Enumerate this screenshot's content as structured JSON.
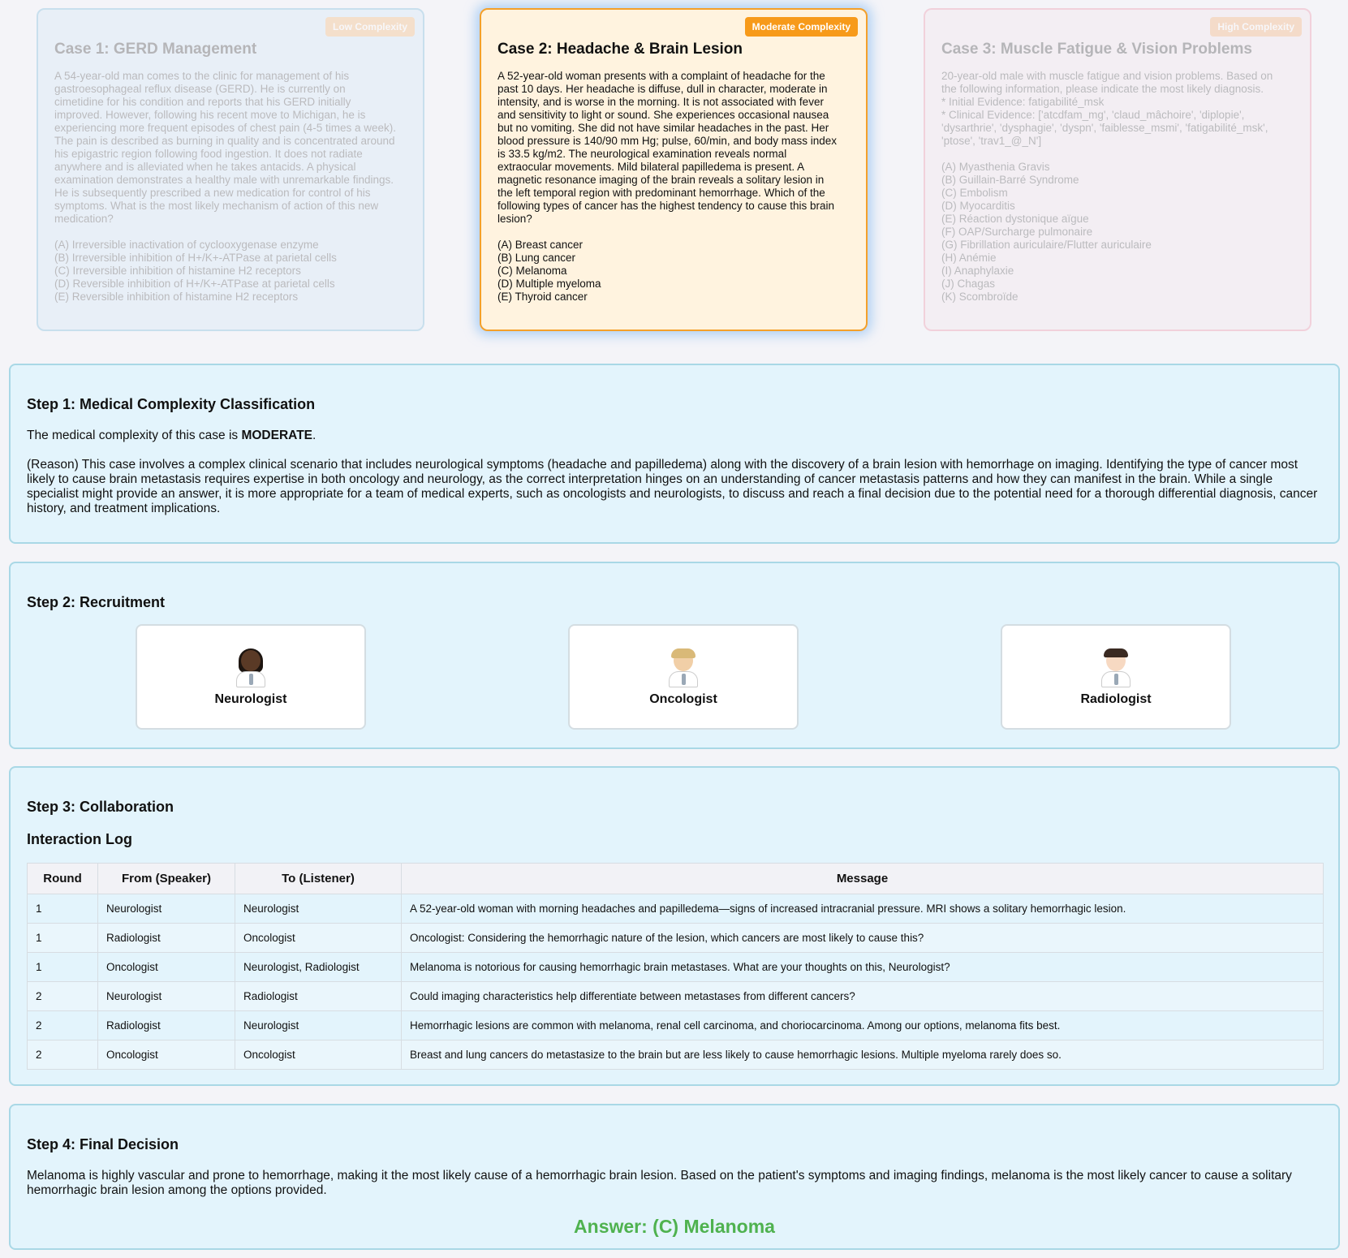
{
  "cases": [
    {
      "badge": "Low Complexity",
      "title": "Case 1: GERD Management",
      "body": "A 54-year-old man comes to the clinic for management of his\ngastroesophageal reflux disease (GERD). He is currently on\ncimetidine for his condition and reports that his GERD initially\nimproved. However, following his recent move to Michigan, he is\nexperiencing more frequent episodes of chest pain (4-5 times a week).\nThe pain is described as burning in quality and is concentrated around\nhis epigastric region following food ingestion. It does not radiate\nanywhere and is alleviated when he takes antacids. A physical\nexamination demonstrates a healthy male with unremarkable findings.\nHe is subsequently prescribed a new medication for control of his\nsymptoms. What is the most likely mechanism of action of this new\nmedication?",
      "options": [
        "(A) Irreversible inactivation of cyclooxygenase enzyme",
        "(B) Irreversible inhibition of H+/K+-ATPase at parietal cells",
        "(C) Irreversible inhibition of histamine H2 receptors",
        "(D) Reversible inhibition of H+/K+-ATPase at parietal cells",
        "(E) Reversible inhibition of histamine H2 receptors"
      ]
    },
    {
      "badge": "Moderate Complexity",
      "title": "Case 2: Headache & Brain Lesion",
      "body": "A 52-year-old woman presents with a complaint of headache for the\npast 10 days. Her headache is diffuse, dull in character, moderate in\nintensity, and is worse in the morning. It is not associated with fever\nand sensitivity to light or sound. She experiences occasional nausea\nbut no vomiting. She did not have similar headaches in the past. Her\nblood pressure is 140/90 mm Hg; pulse, 60/min, and body mass index\nis 33.5 kg/m2. The neurological examination reveals normal\nextraocular movements. Mild bilateral papilledema is present. A\nmagnetic resonance imaging of the brain reveals a solitary lesion in\nthe left temporal region with predominant hemorrhage. Which of the\nfollowing types of cancer has the highest tendency to cause this brain\nlesion?",
      "options": [
        "(A) Breast cancer",
        "(B) Lung cancer",
        "(C) Melanoma",
        "(D) Multiple myeloma",
        "(E) Thyroid cancer"
      ]
    },
    {
      "badge": "High Complexity",
      "title": "Case 3: Muscle Fatigue & Vision Problems",
      "body": "20-year-old male with muscle fatigue and vision problems. Based on\nthe following information, please indicate the most likely diagnosis.\n* Initial Evidence: fatigabilité_msk\n* Clinical Evidence: ['atcdfam_mg', 'claud_mâchoire', 'diplopie',\n'dysarthrie', 'dysphagie', 'dyspn', 'faiblesse_msmi', 'fatigabilité_msk',\n'ptose', 'trav1_@_N']",
      "options": [
        "(A) Myasthenia Gravis",
        "(B) Guillain-Barré Syndrome",
        "(C) Embolism",
        "(D) Myocarditis",
        "(E) Réaction dystonique aïgue",
        "(F) OAP/Surcharge pulmonaire",
        "(G) Fibrillation auriculaire/Flutter auriculaire",
        "(H) Anémie",
        "(I) Anaphylaxie",
        "(J) Chagas",
        "(K) Scombroïde"
      ]
    }
  ],
  "step1": {
    "title": "Step 1: Medical Complexity Classification",
    "line_prefix": "The medical complexity of this case is ",
    "level": "MODERATE",
    "line_suffix": ".",
    "reason": "(Reason) This case involves a complex clinical scenario that includes neurological symptoms (headache and papilledema) along with the discovery of a brain lesion with hemorrhage on imaging. Identifying the type of cancer most likely to cause brain metastasis requires expertise in both oncology and neurology, as the correct interpretation hinges on an understanding of cancer metastasis patterns and how they can manifest in the brain. While a single specialist might provide an answer, it is more appropriate for a team of medical experts, such as oncologists and neurologists, to discuss and reach a final decision due to the potential need for a thorough differential diagnosis, cancer history, and treatment implications."
  },
  "step2": {
    "title": "Step 2: Recruitment",
    "agents": [
      {
        "name": "Neurologist",
        "icon": "woman-doctor-icon",
        "skin": "#5a3a26",
        "hair": "#1d1510"
      },
      {
        "name": "Oncologist",
        "icon": "doctor-icon",
        "skin": "#f1cfa7",
        "hair": "#d9b978"
      },
      {
        "name": "Radiologist",
        "icon": "man-doctor-icon",
        "skin": "#f7d9c2",
        "hair": "#3a2a22"
      }
    ]
  },
  "step3": {
    "title": "Step 3: Collaboration",
    "subtitle": "Interaction Log",
    "headers": [
      "Round",
      "From (Speaker)",
      "To (Listener)",
      "Message"
    ],
    "rows": [
      [
        "1",
        "Neurologist",
        "Neurologist",
        "A 52-year-old woman with morning headaches and papilledema—signs of increased intracranial pressure. MRI shows a solitary hemorrhagic lesion."
      ],
      [
        "1",
        "Radiologist",
        "Oncologist",
        "Oncologist: Considering the hemorrhagic nature of the lesion, which cancers are most likely to cause this?"
      ],
      [
        "1",
        "Oncologist",
        "Neurologist, Radiologist",
        "Melanoma is notorious for causing hemorrhagic brain metastases. What are your thoughts on this, Neurologist?"
      ],
      [
        "2",
        "Neurologist",
        "Radiologist",
        "Could imaging characteristics help differentiate between metastases from different cancers?"
      ],
      [
        "2",
        "Radiologist",
        "Neurologist",
        "Hemorrhagic lesions are common with melanoma, renal cell carcinoma, and choriocarcinoma. Among our options, melanoma fits best."
      ],
      [
        "2",
        "Oncologist",
        "Oncologist",
        "Breast and lung cancers do metastasize to the brain but are less likely to cause hemorrhagic lesions. Multiple myeloma rarely does so."
      ]
    ]
  },
  "step4": {
    "title": "Step 4: Final Decision",
    "decision": "Melanoma is highly vascular and prone to hemorrhage, making it the most likely cause of a hemorrhagic brain lesion. Based on the patient's symptoms and imaging findings, melanoma is the most likely cancer to cause a solitary hemorrhagic brain lesion among the options provided.",
    "answer": "Answer: (C) Melanoma",
    "answer_color": "#4fb24f"
  },
  "colors": {
    "panel_bg": "#e3f4fc",
    "moderate_accent": "#f79a1a"
  }
}
